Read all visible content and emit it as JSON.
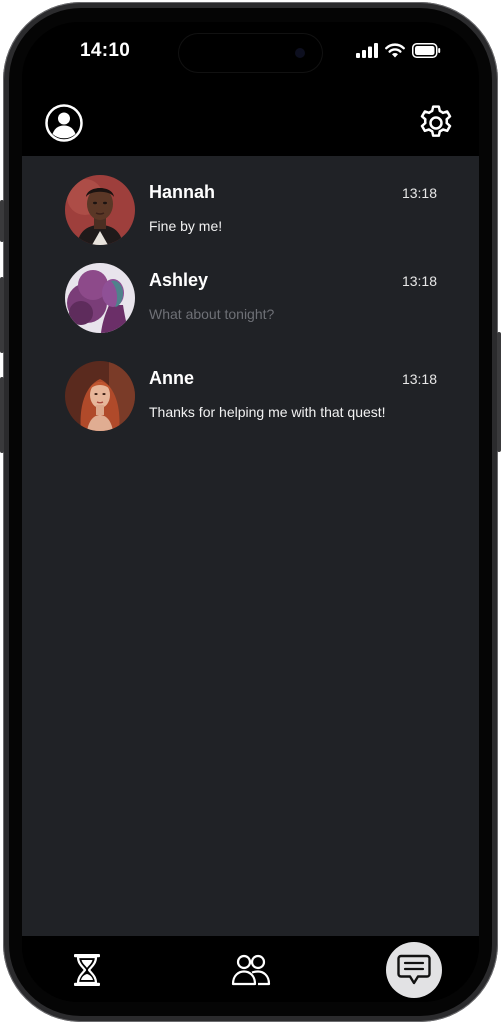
{
  "status_bar": {
    "time": "14:10",
    "icons": [
      "cellular-signal-icon",
      "wifi-icon",
      "battery-icon"
    ]
  },
  "header": {
    "left_icon": "profile-icon",
    "right_icon": "settings-gear-icon"
  },
  "chats": [
    {
      "name": "Hannah",
      "time": "13:18",
      "preview": "Fine by me!",
      "preview_read": true,
      "avatar": "hannah-avatar"
    },
    {
      "name": "Ashley",
      "time": "13:18",
      "preview": "What about tonight?",
      "preview_read": false,
      "avatar": "ashley-avatar"
    },
    {
      "name": "Anne",
      "time": "13:18",
      "preview": "Thanks for helping me with that quest!",
      "preview_read": true,
      "avatar": "anne-avatar"
    }
  ],
  "tab_bar": {
    "tabs": [
      {
        "icon": "hourglass-icon",
        "active": false
      },
      {
        "icon": "people-icon",
        "active": false
      },
      {
        "icon": "chat-bubble-icon",
        "active": true
      }
    ]
  },
  "colors": {
    "screen_bg": "#000000",
    "list_bg": "#202226",
    "text_primary": "#ffffff",
    "text_dim": "#6e7076",
    "active_tab_bg": "#e2e2e4"
  }
}
